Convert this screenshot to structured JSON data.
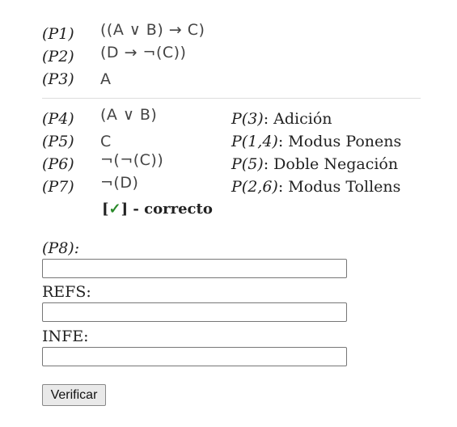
{
  "premises": [
    {
      "label": "(P1)",
      "formula": "((A ∨ B) → C)"
    },
    {
      "label": "(P2)",
      "formula": "(D → ¬(C))"
    },
    {
      "label": "(P3)",
      "formula": "A"
    }
  ],
  "steps": [
    {
      "label": "(P4)",
      "formula": "(A ∨ B)",
      "ref": "P(3)",
      "rule": ": Adición"
    },
    {
      "label": "(P5)",
      "formula": "C",
      "ref": "P(1,4)",
      "rule": ": Modus Ponens"
    },
    {
      "label": "(P6)",
      "formula": "¬(¬(C))",
      "ref": "P(5)",
      "rule": ": Doble Negación"
    },
    {
      "label": "(P7)",
      "formula": "¬(D)",
      "ref": "P(2,6)",
      "rule": ": Modus Tollens"
    }
  ],
  "result": {
    "open": "[",
    "check": "✓",
    "close": "]",
    "text": " - correcto"
  },
  "form": {
    "step_label": "(P8):",
    "refs_label": "REFS:",
    "infe_label": "INFE:",
    "step_value": "",
    "refs_value": "",
    "infe_value": "",
    "button_label": "Verificar"
  },
  "colors": {
    "check": "#2a8a2a",
    "divider": "#dddddd"
  }
}
